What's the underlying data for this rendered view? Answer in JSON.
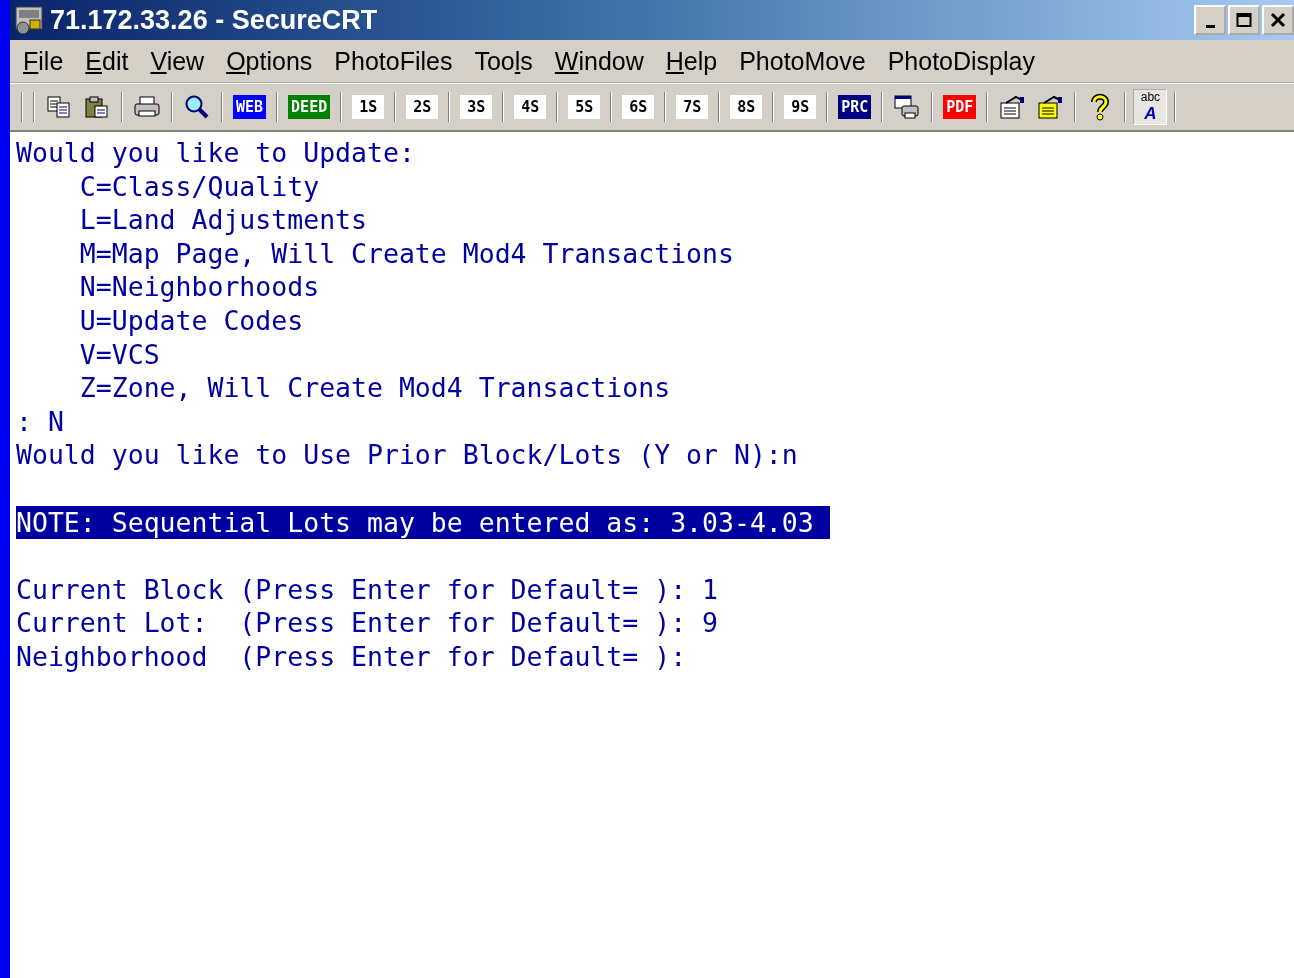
{
  "window": {
    "title": "71.172.33.26 - SecureCRT"
  },
  "menu": [
    {
      "kind": "access-key",
      "key": "F",
      "after": "ile"
    },
    {
      "kind": "access-key",
      "key": "E",
      "after": "dit"
    },
    {
      "kind": "access-key",
      "key": "V",
      "after": "iew"
    },
    {
      "kind": "access-key",
      "key": "O",
      "after": "ptions"
    },
    {
      "kind": "plain",
      "label": "PhotoFiles"
    },
    {
      "kind": "access-key",
      "before": "Too",
      "key": "l",
      "after": "s"
    },
    {
      "kind": "access-key",
      "key": "W",
      "after": "indow"
    },
    {
      "kind": "access-key",
      "key": "H",
      "after": "elp"
    },
    {
      "kind": "plain",
      "label": "PhotoMove"
    },
    {
      "kind": "plain",
      "label": "PhotoDisplay"
    }
  ],
  "toolbar": [
    [
      {
        "kind": "copy",
        "pressed": false
      },
      {
        "kind": "paste",
        "pressed": false
      }
    ],
    [
      {
        "kind": "print",
        "pressed": false
      }
    ],
    [
      {
        "kind": "find",
        "pressed": false
      }
    ],
    [
      {
        "kind": "badge",
        "text": "WEB",
        "color": "#0000ff",
        "pressed": false
      }
    ],
    [
      {
        "kind": "badge",
        "text": "DEED",
        "color": "#008000",
        "pressed": false
      }
    ],
    [
      {
        "kind": "badge",
        "text": "1S",
        "color": "#ffffff",
        "pressed": false
      }
    ],
    [
      {
        "kind": "badge",
        "text": "2S",
        "color": "#ffffff",
        "pressed": false
      }
    ],
    [
      {
        "kind": "badge",
        "text": "3S",
        "color": "#ffffff",
        "pressed": false
      }
    ],
    [
      {
        "kind": "badge",
        "text": "4S",
        "color": "#ffffff",
        "pressed": false
      }
    ],
    [
      {
        "kind": "badge",
        "text": "5S",
        "color": "#ffffff",
        "pressed": false
      }
    ],
    [
      {
        "kind": "badge",
        "text": "6S",
        "color": "#ffffff",
        "pressed": false
      }
    ],
    [
      {
        "kind": "badge",
        "text": "7S",
        "color": "#ffffff",
        "pressed": false
      }
    ],
    [
      {
        "kind": "badge",
        "text": "8S",
        "color": "#ffffff",
        "pressed": false
      }
    ],
    [
      {
        "kind": "badge",
        "text": "9S",
        "color": "#ffffff",
        "pressed": false
      }
    ],
    [
      {
        "kind": "badge",
        "text": "PRC",
        "color": "#000080",
        "pressed": false
      }
    ],
    [
      {
        "kind": "transfer",
        "pressed": false
      }
    ],
    [
      {
        "kind": "badge",
        "text": "PDF",
        "color": "#ff0000",
        "pressed": false
      }
    ],
    [
      {
        "kind": "properties",
        "pressed": false
      },
      {
        "kind": "properties-alt",
        "pressed": false
      }
    ],
    [
      {
        "kind": "help",
        "pressed": false
      }
    ],
    [
      {
        "kind": "font",
        "text": "abc",
        "letter": "A",
        "pressed": true
      }
    ]
  ],
  "terminal": {
    "lines": [
      {
        "kind": "text",
        "text": "Would you like to Update:"
      },
      {
        "kind": "text",
        "text": "    C=Class/Quality"
      },
      {
        "kind": "text",
        "text": "    L=Land Adjustments"
      },
      {
        "kind": "text",
        "text": "    M=Map Page, Will Create Mod4 Transactions"
      },
      {
        "kind": "text",
        "text": "    N=Neighborhoods"
      },
      {
        "kind": "text",
        "text": "    U=Update Codes"
      },
      {
        "kind": "text",
        "text": "    V=VCS"
      },
      {
        "kind": "text",
        "text": "    Z=Zone, Will Create Mod4 Transactions"
      },
      {
        "kind": "text",
        "text": ": N"
      },
      {
        "kind": "text",
        "text": "Would you like to Use Prior Block/Lots (Y or N):n"
      },
      {
        "kind": "blank"
      },
      {
        "kind": "highlight",
        "text": "NOTE: Sequential Lots may be entered as: 3.03-4.03 "
      },
      {
        "kind": "blank"
      },
      {
        "kind": "text",
        "text": "Current Block (Press Enter for Default= ): 1"
      },
      {
        "kind": "text",
        "text": "Current Lot:  (Press Enter for Default= ): 9"
      },
      {
        "kind": "text",
        "text": "Neighborhood  (Press Enter for Default= ):"
      }
    ]
  }
}
